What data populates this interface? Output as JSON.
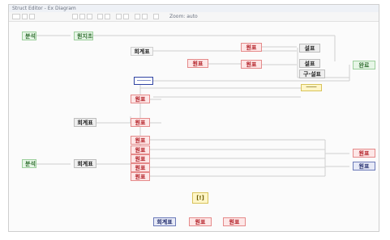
{
  "window": {
    "title": "Struct Editor - Ex Diagram"
  },
  "toolbar": {
    "zoom_label": "Zoom: auto"
  },
  "nodes": {
    "green_left_top": "분석",
    "green_left_mid": "분석",
    "green_head": "원지초",
    "gray_top": "회계표",
    "gray_mid": "회계표",
    "gray_bottom": "회계표",
    "red_top_1": "원표",
    "red_top_2": "원표",
    "red_mid_1": "원표",
    "red_mid_2": "원표",
    "list_1": "설표",
    "list_2": "설표",
    "list_3": "구·설표",
    "bright_green_right": "완료",
    "blue_box": "────",
    "yellow_bar": "───",
    "red_col_1": "원표",
    "red_col_2": "원표",
    "red_col_3": "원표",
    "red_col_4": "원표",
    "red_col_5": "원표",
    "red_col_6": "원표",
    "red_right": "원표",
    "navy_right": "원표",
    "center_yellow": "[!]",
    "bottom_1": "회계표",
    "bottom_2": "원표",
    "bottom_3": "원표"
  }
}
